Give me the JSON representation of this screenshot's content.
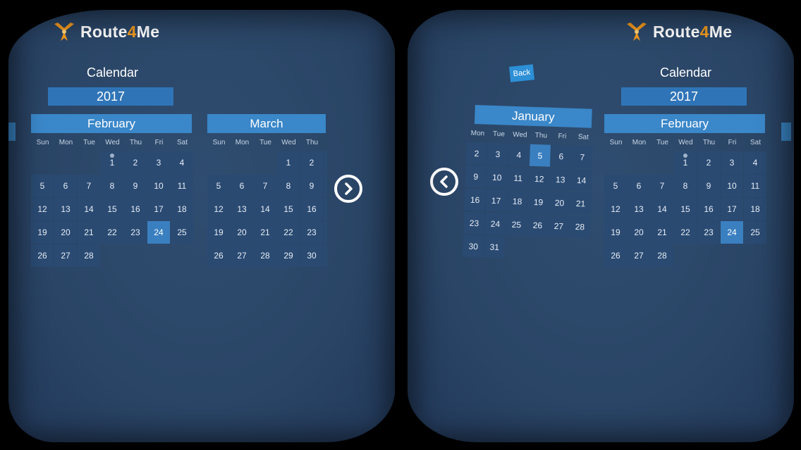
{
  "brand": {
    "name_prefix": "Route",
    "name_digit": "4",
    "name_suffix": "Me",
    "accent_color": "#f39a1e"
  },
  "calendar": {
    "title": "Calendar",
    "year": "2017",
    "weekdays": [
      "Sun",
      "Mon",
      "Tue",
      "Wed",
      "Thu",
      "Fri",
      "Sat"
    ],
    "weekdays_january": [
      "Mon",
      "Tue",
      "Wed",
      "Thu",
      "Fri",
      "Sat"
    ],
    "back_label": "Back",
    "months": {
      "january": {
        "name": "January"
      },
      "february": {
        "name": "February",
        "selected_day": "24",
        "today_day": "1"
      },
      "march": {
        "name": "March"
      }
    }
  },
  "nav": {
    "next_icon": "chevron-right-icon",
    "prev_icon": "chevron-left-icon"
  },
  "colors": {
    "panel": "#2a4566",
    "month_header": "#3a87c9",
    "year_bar": "#2f74b7",
    "day_cell": "#2a4a72",
    "selected": "#3a7fc0"
  }
}
